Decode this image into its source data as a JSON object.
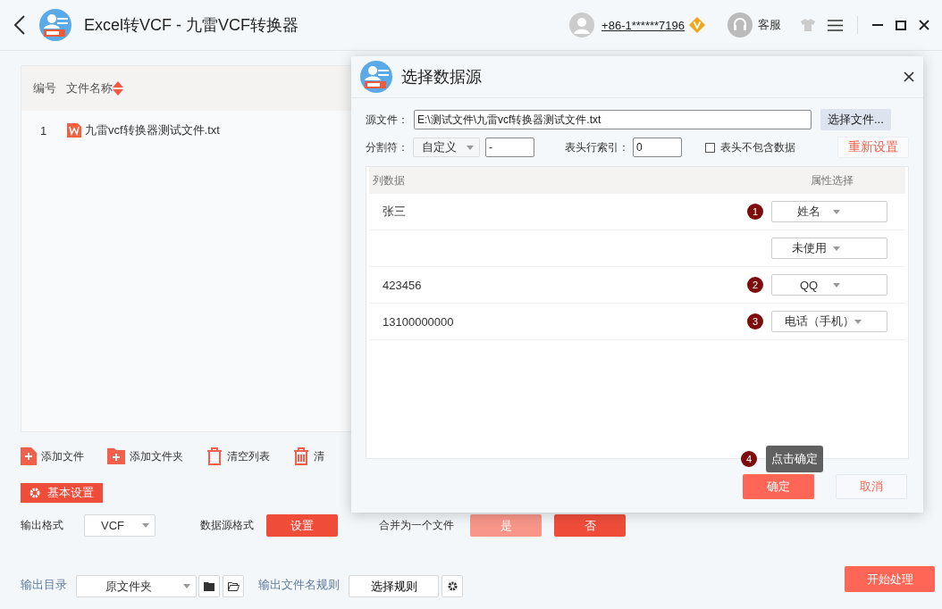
{
  "title_bar": {
    "title": "Excel转VCF - 九雷VCF转换器",
    "account": "+86-1******7196",
    "service": "客服"
  },
  "file_table": {
    "columns": [
      "编号",
      "文件名称"
    ],
    "rows": [
      {
        "number": "1",
        "file_name": "九雷vcf转换器测试文件.txt"
      }
    ]
  },
  "toolbar": [
    {
      "kind": "file",
      "label": "添加文件"
    },
    {
      "kind": "folder",
      "label": "添加文件夹"
    },
    {
      "kind": "trash",
      "label": "清空列表"
    },
    {
      "kind": "remove",
      "label": "清"
    }
  ],
  "basic_settings": {
    "label": "基本设置",
    "output_format_label": "输出格式",
    "output_format": "VCF",
    "source_format_label": "数据源格式",
    "source_format_button": "设置",
    "merge_label": "合并为一个文件",
    "merge_options": [
      {
        "label": "是",
        "selected": false
      },
      {
        "label": "否",
        "selected": true
      }
    ]
  },
  "output": {
    "directory_label": "输出目录",
    "directory": "原文件夹",
    "filename_rule_label": "输出文件名规则",
    "filename_rule_button": "选择规则",
    "start_button": "开始处理"
  },
  "dialog": {
    "title": "选择数据源",
    "source_file_label": "源文件：",
    "source_file": "E:\\测试文件\\九雷vcf转换器测试文件.txt",
    "choose_file_button": "选择文件...",
    "separator_label": "分割符：",
    "separator_type": "自定义",
    "separator_value": "-",
    "header_index_label": "表头行索引：",
    "header_index": "0",
    "no_header_data": {
      "label": "表头不包含数据",
      "checked": false
    },
    "reset_button": "重新设置",
    "columns": [
      "列数据",
      "属性选择"
    ],
    "rows": [
      {
        "value": "张三",
        "step": "1",
        "attribute": "姓名"
      },
      {
        "attribute": "未使用"
      },
      {
        "value": "423456",
        "step": "2",
        "attribute": "QQ"
      },
      {
        "value": "13100000000",
        "step": "3",
        "attribute": "电话（手机）"
      }
    ],
    "tooltip": {
      "step": "4",
      "text": "点击确定"
    },
    "ok_button": "确定",
    "cancel_button": "取消"
  }
}
